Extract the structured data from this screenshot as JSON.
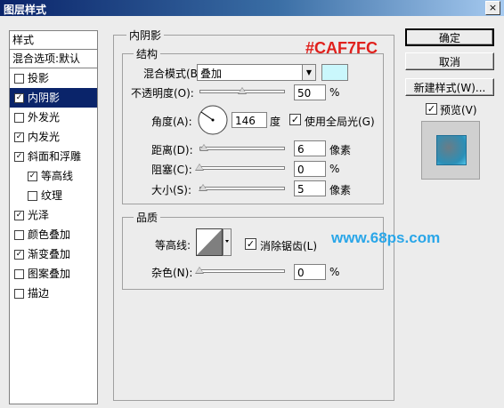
{
  "window": {
    "title": "图层样式",
    "close_glyph": "×"
  },
  "styles_list": {
    "header": "样式",
    "blend_default": "混合选项:默认",
    "items": [
      {
        "label": "投影",
        "checked": false
      },
      {
        "label": "内阴影",
        "checked": true,
        "selected": true
      },
      {
        "label": "外发光",
        "checked": false
      },
      {
        "label": "内发光",
        "checked": true
      },
      {
        "label": "斜面和浮雕",
        "checked": true
      },
      {
        "label": "等高线",
        "checked": true,
        "sub": true
      },
      {
        "label": "纹理",
        "checked": false,
        "sub": true
      },
      {
        "label": "光泽",
        "checked": true
      },
      {
        "label": "颜色叠加",
        "checked": false
      },
      {
        "label": "渐变叠加",
        "checked": true
      },
      {
        "label": "图案叠加",
        "checked": false
      },
      {
        "label": "描边",
        "checked": false
      }
    ]
  },
  "section_title": "内阴影",
  "structure": {
    "legend": "结构",
    "blend_mode_label": "混合模式(B):",
    "blend_mode_value": "叠加",
    "color_swatch": "#CAF7FC",
    "opacity_label": "不透明度(O):",
    "opacity_value": "50",
    "opacity_unit": "%",
    "opacity_level": 0.5,
    "angle_label": "角度(A):",
    "angle_value": "146",
    "angle_unit": "度",
    "global_light_label": "使用全局光(G)",
    "global_light_checked": true,
    "distance_label": "距离(D):",
    "distance_value": "6",
    "distance_unit": "像素",
    "choke_label": "阻塞(C):",
    "choke_value": "0",
    "choke_unit": "%",
    "size_label": "大小(S):",
    "size_value": "5",
    "size_unit": "像素"
  },
  "quality": {
    "legend": "品质",
    "contour_label": "等高线:",
    "antialias_label": "消除锯齿(L)",
    "antialias_checked": true,
    "noise_label": "杂色(N):",
    "noise_value": "0",
    "noise_unit": "%"
  },
  "buttons": {
    "ok": "确定",
    "cancel": "取消",
    "new_style": "新建样式(W)...",
    "preview_label": "预览(V)",
    "preview_checked": true
  },
  "watermarks": {
    "hex": "#CAF7FC",
    "url": "www.68ps.com"
  },
  "check_glyph": "✓"
}
